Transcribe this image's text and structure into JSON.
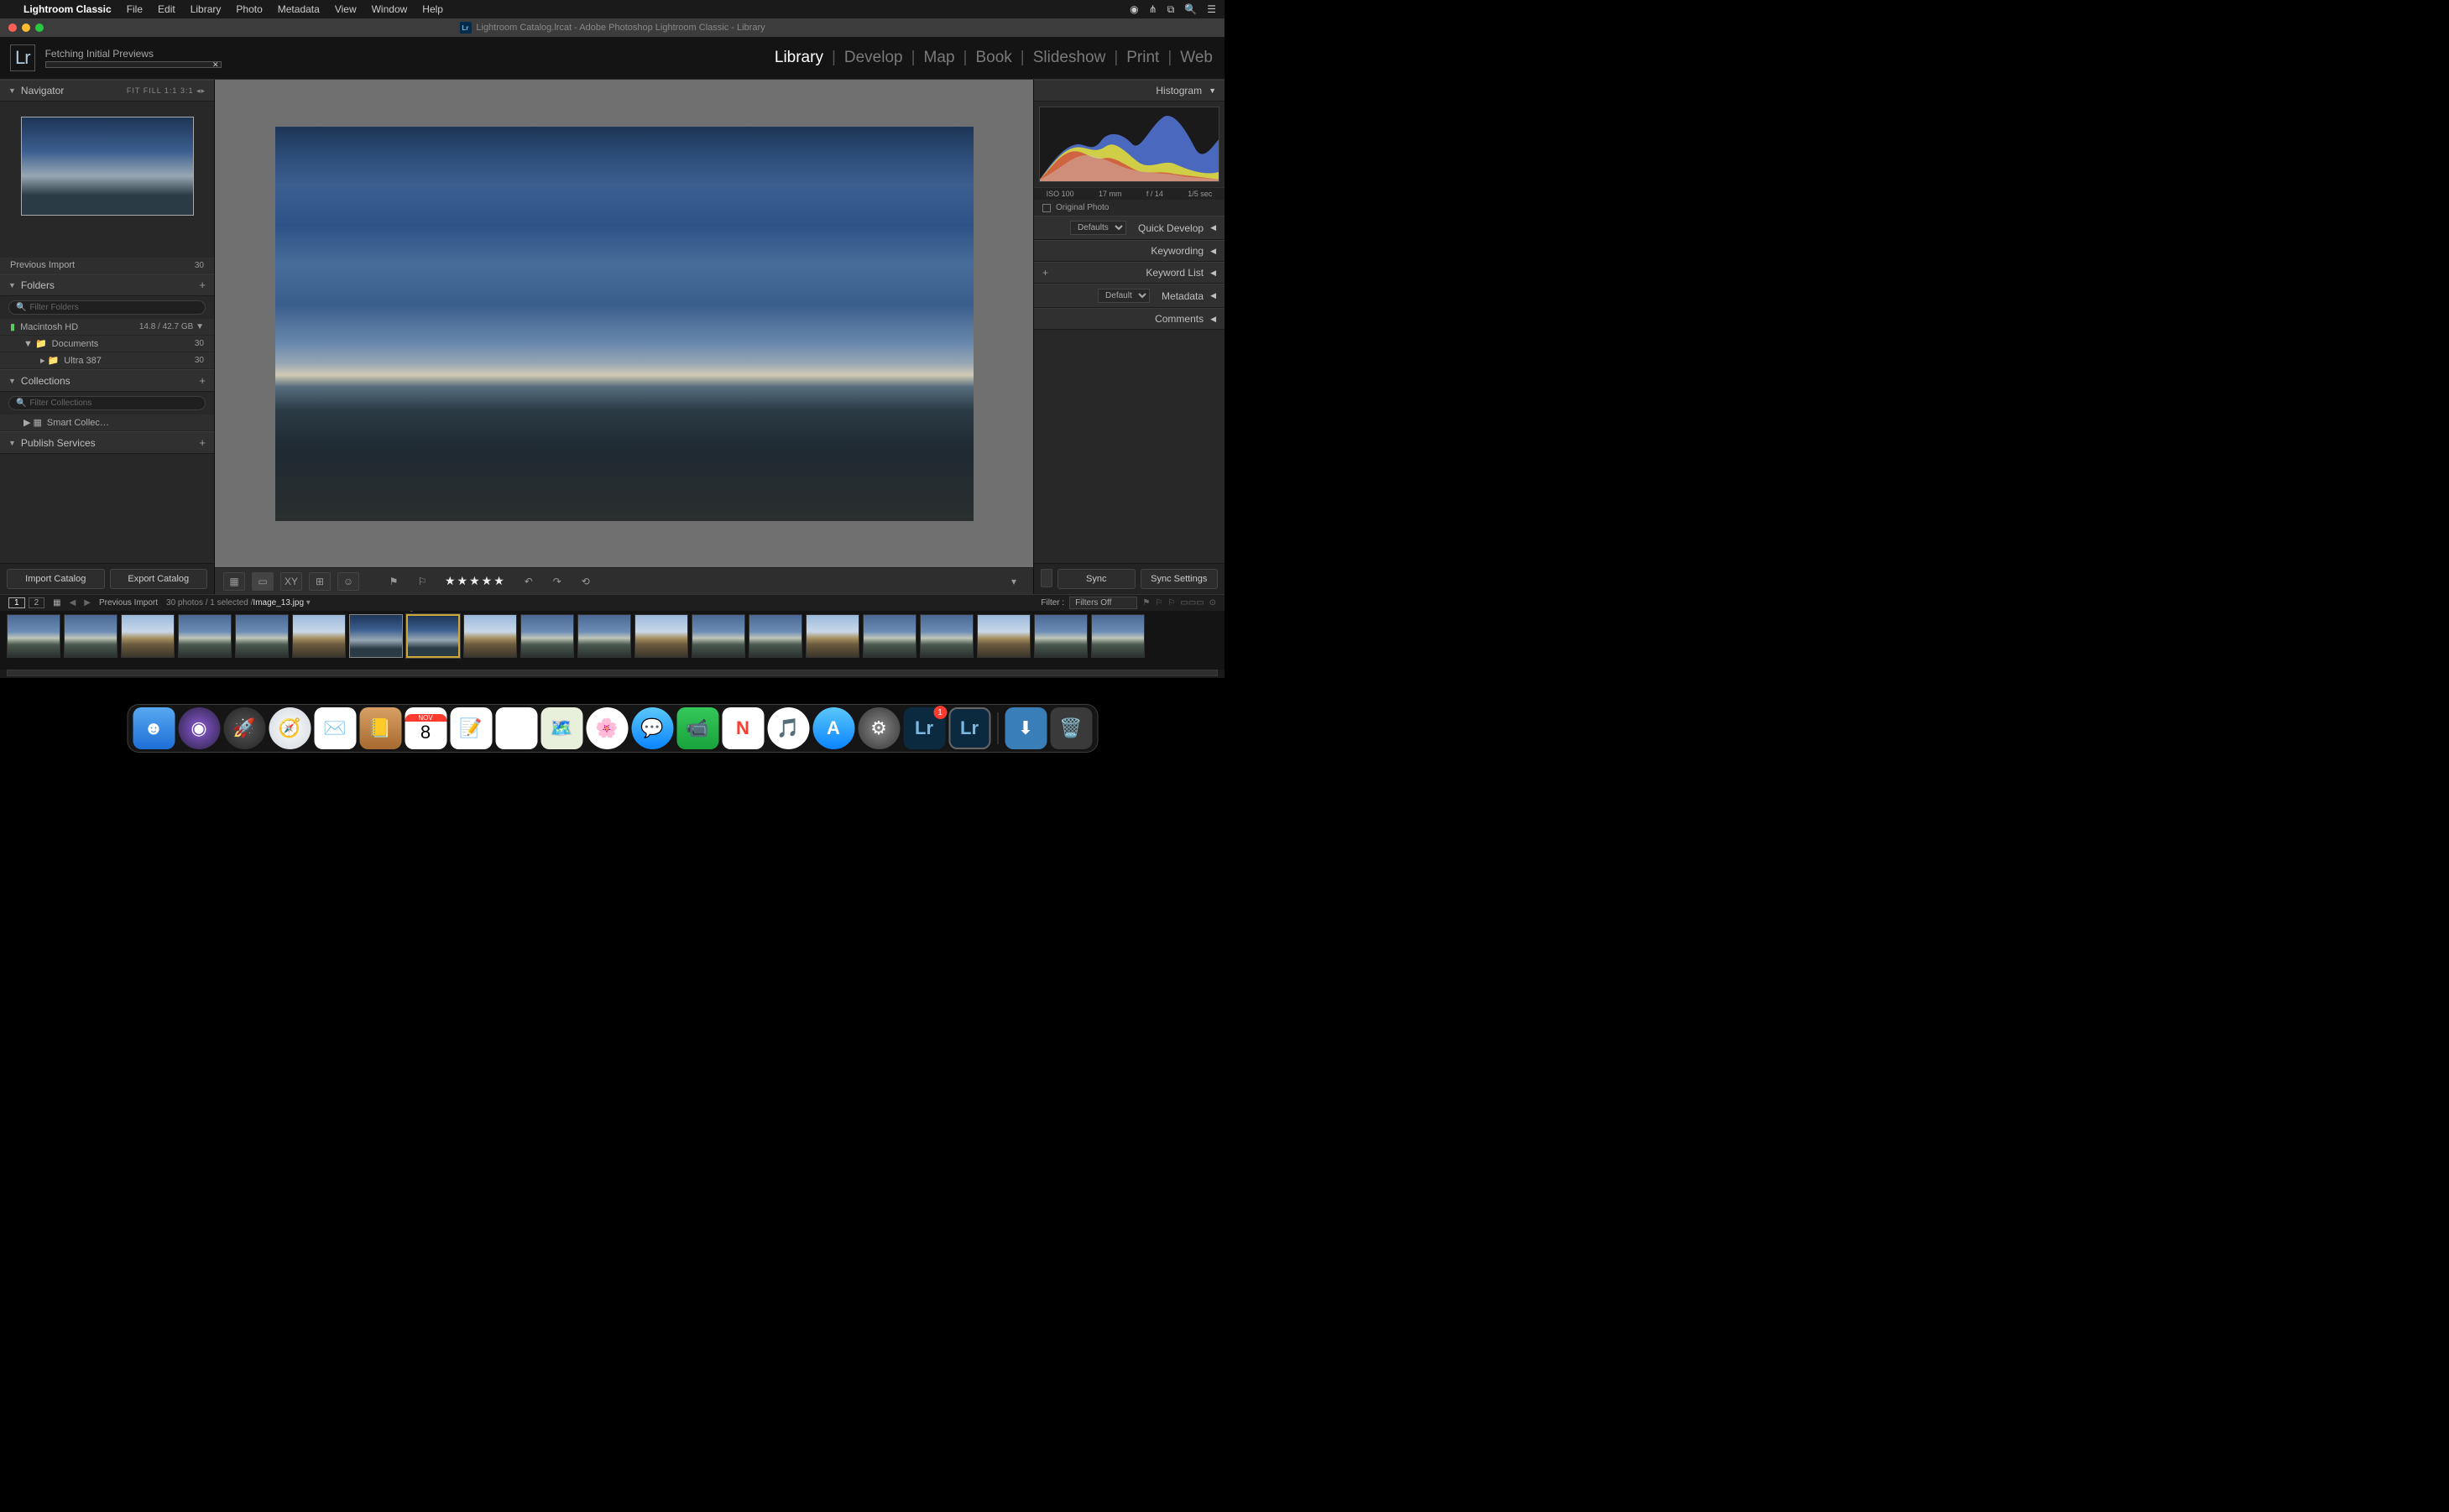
{
  "menubar": {
    "app": "Lightroom Classic",
    "items": [
      "File",
      "Edit",
      "Library",
      "Photo",
      "Metadata",
      "View",
      "Window",
      "Help"
    ]
  },
  "window": {
    "title": "Lightroom Catalog.lrcat - Adobe Photoshop Lightroom Classic - Library"
  },
  "topbar": {
    "logo": "Lr",
    "status_text": "Fetching Initial Previews",
    "modules": [
      "Library",
      "Develop",
      "Map",
      "Book",
      "Slideshow",
      "Print",
      "Web"
    ],
    "active_module": "Library"
  },
  "left": {
    "navigator": {
      "title": "Navigator",
      "opts": "FIT   FILL   1:1   3:1  ◂▸"
    },
    "prev_import": {
      "label": "Previous Import",
      "count": "30"
    },
    "folders": {
      "title": "Folders",
      "filter_placeholder": "Filter Folders",
      "disk": {
        "name": "Macintosh HD",
        "usage": "14.8 / 42.7 GB"
      },
      "items": [
        {
          "name": "Documents",
          "count": "30"
        },
        {
          "name": "Ultra 387",
          "count": "30"
        }
      ]
    },
    "collections": {
      "title": "Collections",
      "filter_placeholder": "Filter Collections",
      "item": "Smart Collec…"
    },
    "publish": {
      "title": "Publish Services"
    },
    "import_btn": "Import Catalog",
    "export_btn": "Export Catalog"
  },
  "center": {
    "stars": "★★★★★"
  },
  "right": {
    "histogram": {
      "title": "Histogram",
      "iso": "ISO 100",
      "focal": "17 mm",
      "aperture": "f / 14",
      "shutter": "1/5 sec"
    },
    "original_photo": "Original Photo",
    "quick_dev": {
      "dropdown": "Defaults",
      "title": "Quick Develop"
    },
    "keywording": "Keywording",
    "keyword_list": "Keyword List",
    "metadata": {
      "dropdown": "Default",
      "title": "Metadata"
    },
    "comments": "Comments",
    "sync_btn": "Sync",
    "sync_settings_btn": "Sync Settings"
  },
  "filmstrip": {
    "source": "Previous Import",
    "count_text": "30 photos / 1 selected /",
    "filename": "Image_13.jpg",
    "filter_label": "Filter :",
    "filter_value": "Filters Off",
    "thumbs": 20,
    "selected_index": 8,
    "prev_selected_index": 7
  },
  "dock": {
    "badge": "1",
    "calendar_month": "NOV",
    "calendar_day": "8"
  }
}
